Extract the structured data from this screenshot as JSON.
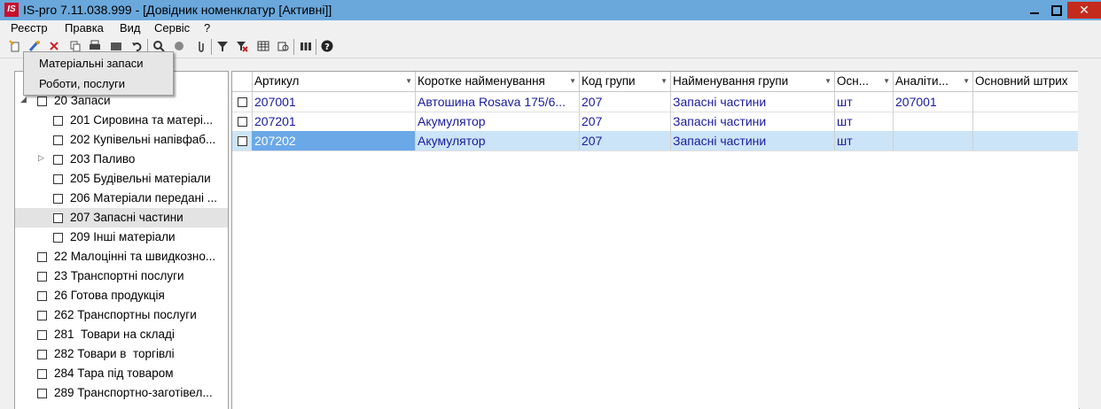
{
  "window": {
    "logo": "IS",
    "title": "IS-pro 7.11.038.999 - [Довідник номенклатур [Активні]]",
    "close_glyph": "✕"
  },
  "menu": [
    "Реєстр",
    "Правка",
    "Вид",
    "Сервіс",
    "?"
  ],
  "popup": {
    "items": [
      "Матеріальні запаси",
      "Роботи, послуги"
    ]
  },
  "tree": [
    {
      "label": "20 Запаси",
      "level": 1,
      "expanded": true
    },
    {
      "label": "201 Сировина та матері...",
      "level": 2
    },
    {
      "label": "202 Купівельні напівфаб...",
      "level": 2
    },
    {
      "label": "203 Паливо",
      "level": 2,
      "collapsed": true
    },
    {
      "label": "205 Будівельні матеріали",
      "level": 2
    },
    {
      "label": "206 Матеріали передані ...",
      "level": 2
    },
    {
      "label": "207 Запасні частини",
      "level": 2,
      "selected": true
    },
    {
      "label": "209 Інші матеріали",
      "level": 2
    },
    {
      "label": "22 Малоцінні та швидкозно...",
      "level": 1
    },
    {
      "label": "23 Транспортні послуги",
      "level": 1
    },
    {
      "label": "26 Готова продукція",
      "level": 1
    },
    {
      "label": "262 Транспортны послуги",
      "level": 1
    },
    {
      "label": "281  Товари на складі",
      "level": 1
    },
    {
      "label": "282 Товари в  торгівлі",
      "level": 1
    },
    {
      "label": "284 Тара під товаром",
      "level": 1
    },
    {
      "label": "289 Транспортно-заготівел...",
      "level": 1
    }
  ],
  "grid": {
    "columns": [
      "Артикул",
      "Коротке найменування",
      "Код групи",
      "Найменування групи",
      "Осн...",
      "Аналіти...",
      "Основний штрих"
    ],
    "rows": [
      [
        "207001",
        "Автошина Rosava 175/6...",
        "207",
        "Запасні частини",
        "шт",
        "207001",
        ""
      ],
      [
        "207201",
        "Акумулятор",
        "207",
        "Запасні частини",
        "шт",
        "",
        ""
      ],
      [
        "207202",
        "Акумулятор",
        "207",
        "Запасні частини",
        "шт",
        "",
        ""
      ]
    ],
    "selected_row": 2
  },
  "colors": {
    "titlebar": "#6aa8dc",
    "close": "#c42b1c",
    "selected_row": "#cce4f7",
    "selected_cell": "#6aa8e8",
    "cell_text": "#1a1aa0"
  }
}
